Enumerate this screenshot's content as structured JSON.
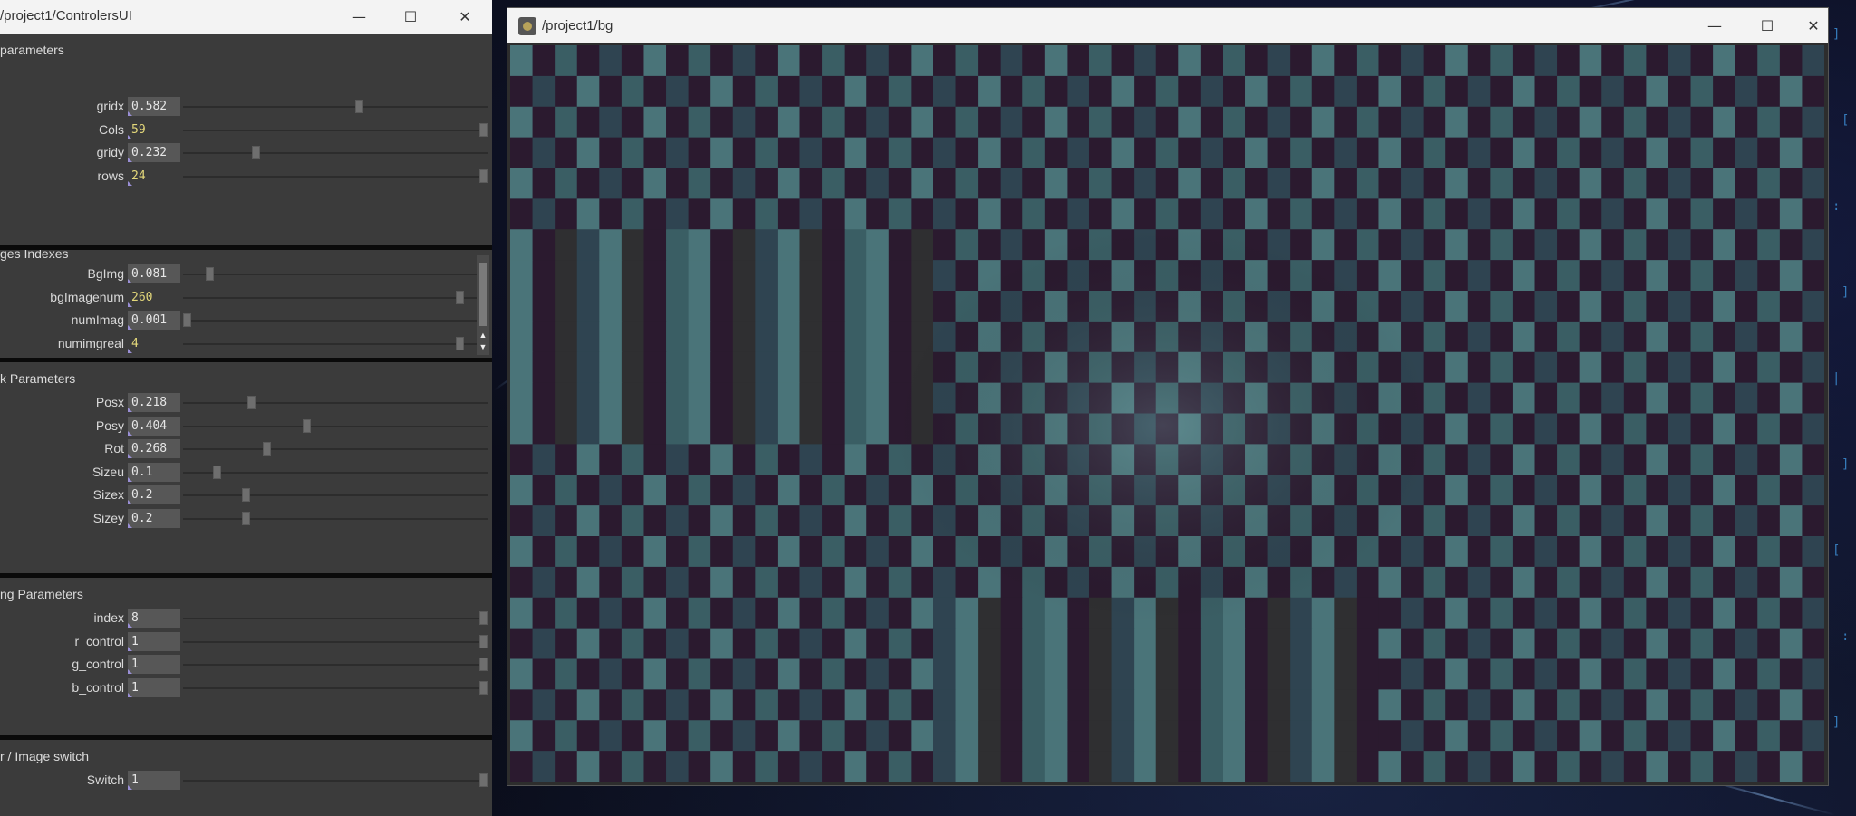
{
  "controllers_window": {
    "title": "/project1/ControlersUI",
    "buttons": {
      "minimize": "—",
      "maximize": "☐",
      "close": "✕"
    },
    "sections": [
      {
        "title": "parameters",
        "params": [
          {
            "label": "gridx",
            "value": "0.582",
            "level": 0.582,
            "kind": "float"
          },
          {
            "label": "Cols",
            "value": "59",
            "level": 1.0,
            "kind": "int"
          },
          {
            "label": "gridy",
            "value": "0.232",
            "level": 0.232,
            "kind": "float"
          },
          {
            "label": "rows",
            "value": "24",
            "level": 1.0,
            "kind": "int"
          }
        ]
      },
      {
        "title": "ges Indexes",
        "params": [
          {
            "label": "BgImg",
            "value": "0.081",
            "level": 0.081,
            "kind": "float"
          },
          {
            "label": "bgImagenum",
            "value": "260",
            "level": 0.98,
            "kind": "int"
          },
          {
            "label": "numImag",
            "value": "0.001",
            "level": 0.001,
            "kind": "float"
          },
          {
            "label": "numimgreal",
            "value": "4",
            "level": 0.98,
            "kind": "int"
          }
        ]
      },
      {
        "title": "k Parameters",
        "params": [
          {
            "label": "Posx",
            "value": "0.218",
            "level": 0.218,
            "kind": "float"
          },
          {
            "label": "Posy",
            "value": "0.404",
            "level": 0.404,
            "kind": "float"
          },
          {
            "label": "Rot",
            "value": "0.268",
            "level": 0.268,
            "kind": "float"
          },
          {
            "label": "Sizeu",
            "value": "0.1",
            "level": 0.1,
            "kind": "float"
          },
          {
            "label": "Sizex",
            "value": "0.2",
            "level": 0.2,
            "kind": "float"
          },
          {
            "label": "Sizey",
            "value": "0.2",
            "level": 0.2,
            "kind": "float"
          }
        ]
      },
      {
        "title": "ng Parameters",
        "params": [
          {
            "label": "index",
            "value": "8",
            "level": 1.0,
            "kind": "intbox"
          },
          {
            "label": "r_control",
            "value": "1",
            "level": 1.0,
            "kind": "intbox"
          },
          {
            "label": "g_control",
            "value": "1",
            "level": 1.0,
            "kind": "intbox"
          },
          {
            "label": "b_control",
            "value": "1",
            "level": 1.0,
            "kind": "intbox"
          }
        ]
      },
      {
        "title": "r / Image switch",
        "params": [
          {
            "label": "Switch",
            "value": "1",
            "level": 1.0,
            "kind": "intbox"
          }
        ]
      }
    ]
  },
  "bg_window": {
    "title": "/project1/bg",
    "buttons": {
      "minimize": "—",
      "maximize": "☐",
      "close": "✕"
    },
    "canvas": {
      "cols": 59,
      "rows": 24,
      "colors": [
        "#4a7479",
        "#2f2f31",
        "#2b1a2f",
        "#2f4451",
        "#3a5e64"
      ]
    }
  },
  "desktop": {
    "accent": "#3c8cd2",
    "glyphs": [
      "]",
      "[",
      ":",
      "]",
      "|",
      "]",
      "[",
      ":",
      "]"
    ]
  }
}
